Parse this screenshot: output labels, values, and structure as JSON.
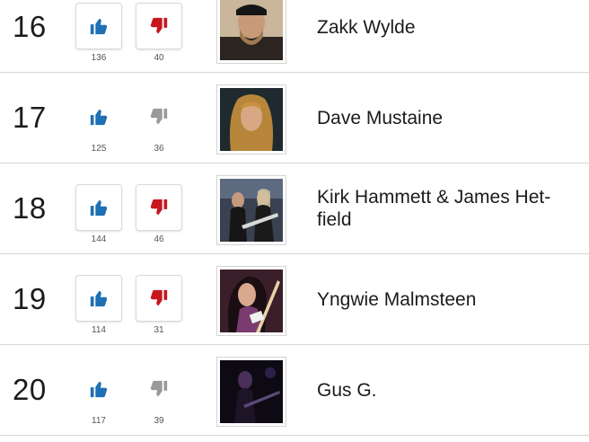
{
  "colors": {
    "up_blue": "#1f6fb5",
    "down_red": "#c7161e",
    "inactive_gray": "#9a9a9a"
  },
  "icons": {
    "upvote": "thumbs-up-icon",
    "downvote": "thumbs-down-icon"
  },
  "rows": [
    {
      "rank": "16",
      "name": "Zakk Wylde",
      "up": "136",
      "down": "40",
      "down_active": true
    },
    {
      "rank": "17",
      "name": "Dave Mustaine",
      "up": "125",
      "down": "36",
      "down_active": false
    },
    {
      "rank": "18",
      "name": "Kirk Hammett & James Het-field",
      "up": "144",
      "down": "46",
      "down_active": true
    },
    {
      "rank": "19",
      "name": "Yngwie Malmsteen",
      "up": "114",
      "down": "31",
      "down_active": true
    },
    {
      "rank": "20",
      "name": "Gus G.",
      "up": "117",
      "down": "39",
      "down_active": false
    }
  ]
}
